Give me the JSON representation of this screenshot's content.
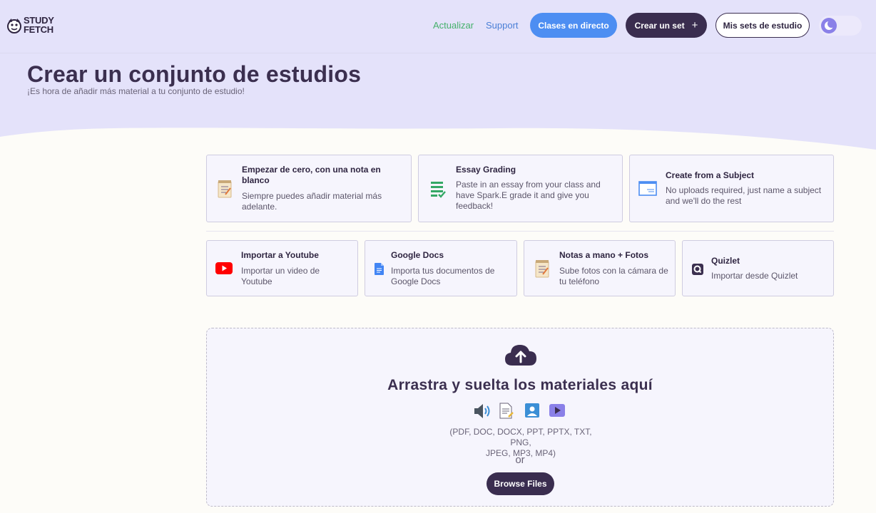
{
  "header": {
    "logo_text_line1": "STUDY",
    "logo_text_line2": "FETCH",
    "nav": {
      "update_label": "Actualizar",
      "support_label": "Support",
      "live_classes_label": "Clases en directo",
      "create_set_label": "Crear un set",
      "create_set_icon": "plus-icon",
      "my_sets_label": "Mis sets de estudio",
      "theme_toggle_icon": "moon-icon"
    }
  },
  "hero": {
    "title": "Crear un conjunto de estudios",
    "subtitle": "¡Es hora de añadir más material a tu conjunto de estudio!"
  },
  "primary_options": [
    {
      "title": "Empezar de cero, con una nota en blanco",
      "description": "Siempre puedes añadir material más adelante.",
      "icon": "notepad-icon"
    },
    {
      "title": "Essay Grading",
      "description": "Paste in an essay from your class and have Spark.E grade it and give you feedback!",
      "icon": "checklist-icon"
    },
    {
      "title": "Create from a Subject",
      "description": "No uploads required, just name a subject and we'll do the rest",
      "icon": "subject-window-icon"
    }
  ],
  "import_options": [
    {
      "title": "Importar a Youtube",
      "description": "Importar un video de Youtube",
      "icon": "youtube-icon"
    },
    {
      "title": "Google Docs",
      "description": "Importa tus documentos de Google Docs",
      "icon": "google-docs-icon"
    },
    {
      "title": "Notas a mano + Fotos",
      "description": "Sube fotos con la cámara de tu teléfono",
      "icon": "notepad-icon"
    },
    {
      "title": "Quizlet",
      "description": "Importar desde Quizlet",
      "icon": "quizlet-icon"
    }
  ],
  "dropzone": {
    "upload_icon": "cloud-upload-icon",
    "title": "Arrastra y suelta los materiales aquí",
    "file_type_icons": [
      "speaker-icon",
      "document-icon",
      "image-icon",
      "video-icon"
    ],
    "formats_line1": "(PDF, DOC, DOCX, PPT, PPTX, TXT, PNG,",
    "formats_line2": "JPEG, MP3, MP4)",
    "or_text": "or",
    "browse_label": "Browse Files"
  },
  "colors": {
    "hero_background": "#e4e2fa",
    "page_background": "#fdfcf8",
    "primary_dark": "#3a2d4f",
    "accent_blue": "#4d8ef2",
    "update_green": "#45b06b",
    "card_background": "#f6f5fd"
  }
}
